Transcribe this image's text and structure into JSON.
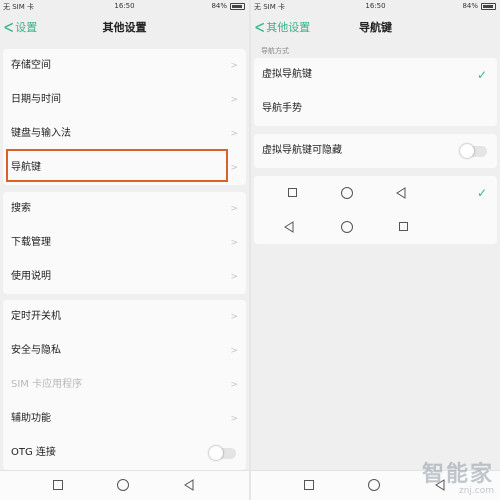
{
  "left_screen": {
    "status": {
      "carrier": "无 SIM 卡",
      "time": "16:50",
      "battery": "84%"
    },
    "header": {
      "back_label": "设置",
      "title": "其他设置"
    },
    "group1": [
      {
        "label": "存储空间"
      },
      {
        "label": "日期与时间"
      },
      {
        "label": "键盘与输入法"
      },
      {
        "label": "导航键"
      }
    ],
    "group2": [
      {
        "label": "搜索"
      },
      {
        "label": "下载管理"
      },
      {
        "label": "使用说明"
      }
    ],
    "group3": [
      {
        "label": "定时开关机"
      },
      {
        "label": "安全与隐私"
      },
      {
        "label": "SIM 卡应用程序",
        "disabled": true
      },
      {
        "label": "辅助功能"
      },
      {
        "label": "OTG 连接",
        "toggle": false
      }
    ]
  },
  "right_screen": {
    "status": {
      "carrier": "无 SIM 卡",
      "time": "16:50",
      "battery": "84%"
    },
    "header": {
      "back_label": "其他设置",
      "title": "导航键"
    },
    "section_caption": "导航方式",
    "nav_modes": [
      {
        "label": "虚拟导航键",
        "selected": true
      },
      {
        "label": "导航手势",
        "selected": false
      }
    ],
    "hide_toggle": {
      "label": "虚拟导航键可隐藏",
      "on": false
    },
    "layouts": [
      {
        "order": [
          "square-icon",
          "circle-icon",
          "back-triangle-icon"
        ],
        "selected": true
      },
      {
        "order": [
          "back-triangle-icon",
          "circle-icon",
          "square-icon"
        ],
        "selected": false
      }
    ]
  },
  "watermark": {
    "brand": "智能家",
    "site": "znj.com"
  },
  "colors": {
    "accent": "#37b388",
    "highlight": "#d9612a",
    "background": "#efefef"
  }
}
